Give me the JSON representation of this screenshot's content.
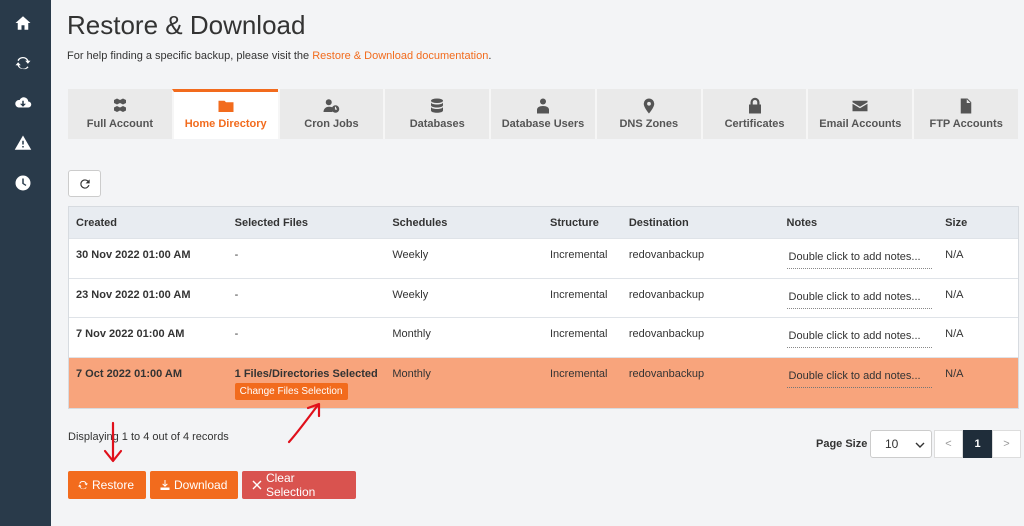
{
  "sidebar": {
    "items": [
      {
        "icon": "home-icon"
      },
      {
        "icon": "sync-icon"
      },
      {
        "icon": "cloud-download-icon"
      },
      {
        "icon": "warning-icon"
      },
      {
        "icon": "clock-icon"
      }
    ]
  },
  "page": {
    "title": "Restore & Download",
    "help_prefix": "For help finding a specific backup, please visit the ",
    "help_link": "Restore & Download documentation",
    "help_suffix": "."
  },
  "tabs": [
    {
      "label": "Full Account",
      "icon": "cubes-icon"
    },
    {
      "label": "Home Directory",
      "icon": "folder-icon",
      "active": true
    },
    {
      "label": "Cron Jobs",
      "icon": "user-clock-icon"
    },
    {
      "label": "Databases",
      "icon": "database-icon"
    },
    {
      "label": "Database Users",
      "icon": "user-icon"
    },
    {
      "label": "DNS Zones",
      "icon": "map-marker-icon"
    },
    {
      "label": "Certificates",
      "icon": "lock-icon"
    },
    {
      "label": "Email Accounts",
      "icon": "envelope-icon"
    },
    {
      "label": "FTP Accounts",
      "icon": "file-icon"
    }
  ],
  "table": {
    "headers": [
      "Created",
      "Selected Files",
      "Schedules",
      "Structure",
      "Destination",
      "Notes",
      "Size"
    ],
    "rows": [
      {
        "created": "30 Nov 2022 01:00 AM",
        "files": "-",
        "schedule": "Weekly",
        "structure": "Incremental",
        "destination": "redovanbackup",
        "notes": "Double click to add notes...",
        "size": "N/A"
      },
      {
        "created": "23 Nov 2022 01:00 AM",
        "files": "-",
        "schedule": "Weekly",
        "structure": "Incremental",
        "destination": "redovanbackup",
        "notes": "Double click to add notes...",
        "size": "N/A"
      },
      {
        "created": "7 Nov 2022 01:00 AM",
        "files": "-",
        "schedule": "Monthly",
        "structure": "Incremental",
        "destination": "redovanbackup",
        "notes": "Double click to add notes...",
        "size": "N/A"
      },
      {
        "created": "7 Oct 2022 01:00 AM",
        "files": "1 Files/Directories Selected",
        "change_button": "Change Files Selection",
        "schedule": "Monthly",
        "structure": "Incremental",
        "destination": "redovanbackup",
        "notes": "Double click to add notes...",
        "size": "N/A",
        "selected": true
      }
    ]
  },
  "footer": {
    "displaying": "Displaying 1 to 4 out of 4 records",
    "page_size_label": "Page Size",
    "page_size_value": "10",
    "pager": {
      "prev": "<",
      "current": "1",
      "next": ">"
    }
  },
  "actions": {
    "restore": "Restore",
    "download": "Download",
    "clear": "Clear Selection"
  },
  "colors": {
    "sidebar": "#293a4a",
    "accent": "#f26b1d",
    "selected_row": "#f8a47c",
    "danger": "#d9534f",
    "annotation": "#e0101b"
  }
}
